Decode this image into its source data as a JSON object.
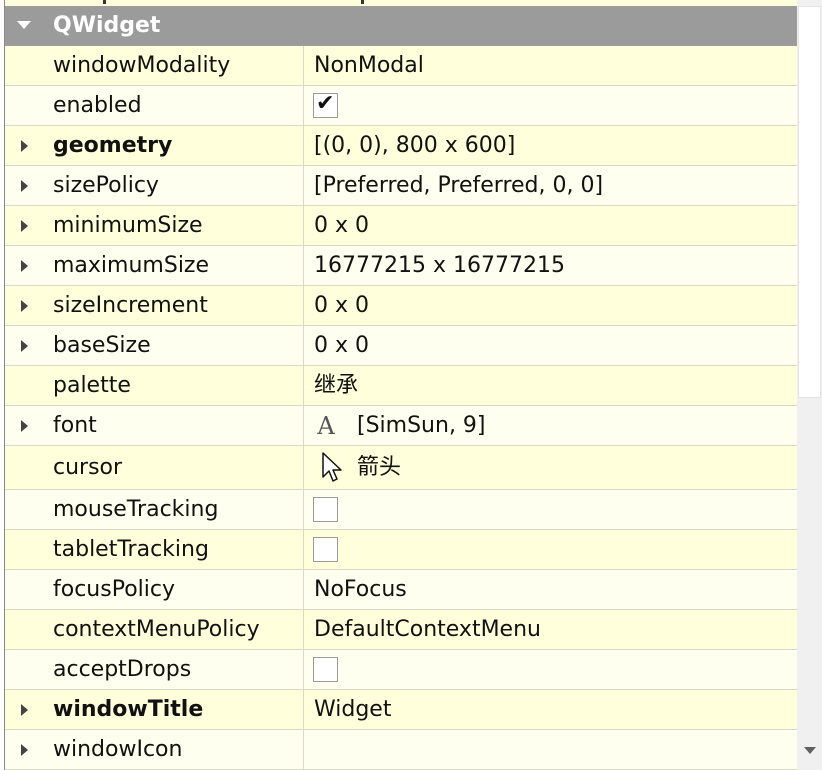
{
  "group": {
    "title": "QWidget"
  },
  "properties": [
    {
      "name": "windowModality",
      "value": "NonModal"
    },
    {
      "name": "enabled",
      "checked": true,
      "check_mark": "✔"
    },
    {
      "name": "geometry",
      "value": "[(0, 0), 800 x 600]"
    },
    {
      "name": "sizePolicy",
      "value": "[Preferred, Preferred, 0, 0]"
    },
    {
      "name": "minimumSize",
      "value": "0 x 0"
    },
    {
      "name": "maximumSize",
      "value": "16777215 x 16777215"
    },
    {
      "name": "sizeIncrement",
      "value": "0 x 0"
    },
    {
      "name": "baseSize",
      "value": "0 x 0"
    },
    {
      "name": "palette",
      "value": "继承"
    },
    {
      "name": "font",
      "value": "[SimSun, 9]",
      "glyph": "A"
    },
    {
      "name": "cursor",
      "value": "箭头",
      "icon": "arrow-cursor-icon"
    },
    {
      "name": "mouseTracking",
      "checked": false
    },
    {
      "name": "tabletTracking",
      "checked": false
    },
    {
      "name": "focusPolicy",
      "value": "NoFocus"
    },
    {
      "name": "contextMenuPolicy",
      "value": "DefaultContextMenu"
    },
    {
      "name": "acceptDrops",
      "checked": false
    },
    {
      "name": "windowTitle",
      "value": "Widget"
    },
    {
      "name": "windowIcon",
      "value": ""
    }
  ]
}
